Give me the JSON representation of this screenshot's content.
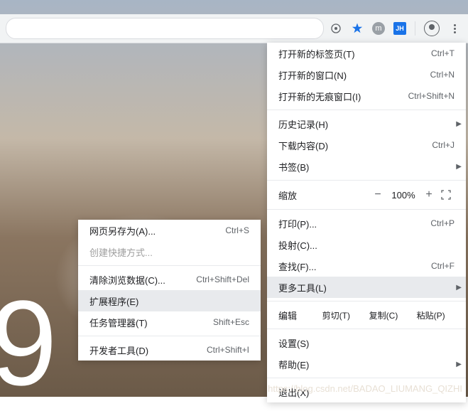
{
  "topbar": {
    "badge_m": "m",
    "badge_jh": "JH"
  },
  "main_menu": {
    "new_tab": {
      "label": "打开新的标签页(T)",
      "kbd": "Ctrl+T"
    },
    "new_window": {
      "label": "打开新的窗口(N)",
      "kbd": "Ctrl+N"
    },
    "incognito": {
      "label": "打开新的无痕窗口(I)",
      "kbd": "Ctrl+Shift+N"
    },
    "history": {
      "label": "历史记录(H)"
    },
    "downloads": {
      "label": "下载内容(D)",
      "kbd": "Ctrl+J"
    },
    "bookmarks": {
      "label": "书签(B)"
    },
    "zoom": {
      "label": "缩放",
      "value": "100%"
    },
    "print": {
      "label": "打印(P)...",
      "kbd": "Ctrl+P"
    },
    "cast": {
      "label": "投射(C)..."
    },
    "find": {
      "label": "查找(F)...",
      "kbd": "Ctrl+F"
    },
    "more_tools": {
      "label": "更多工具(L)"
    },
    "edit": {
      "label": "编辑",
      "cut": "剪切(T)",
      "copy": "复制(C)",
      "paste": "粘贴(P)"
    },
    "settings": {
      "label": "设置(S)"
    },
    "help": {
      "label": "帮助(E)"
    },
    "exit": {
      "label": "退出(X)"
    }
  },
  "sub_menu": {
    "save_as": {
      "label": "网页另存为(A)...",
      "kbd": "Ctrl+S"
    },
    "shortcut": {
      "label": "创建快捷方式..."
    },
    "clear_data": {
      "label": "清除浏览数据(C)...",
      "kbd": "Ctrl+Shift+Del"
    },
    "extensions": {
      "label": "扩展程序(E)"
    },
    "task_manager": {
      "label": "任务管理器(T)",
      "kbd": "Shift+Esc"
    },
    "dev_tools": {
      "label": "开发者工具(D)",
      "kbd": "Ctrl+Shift+I"
    }
  },
  "watermark": "https://blog.csdn.net/BADAO_LIUMANG_QIZHI",
  "big_digit": "9"
}
